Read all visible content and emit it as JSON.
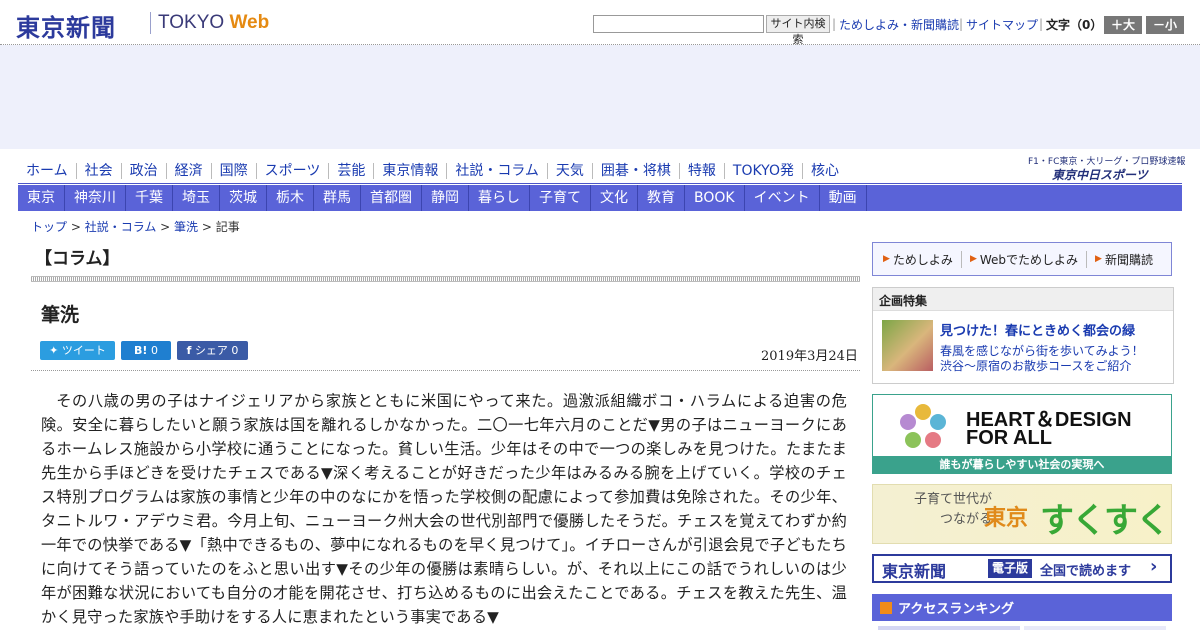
{
  "header": {
    "logo_jp": "東京新聞",
    "logo_en_tokyo": "TOKYO",
    "logo_en_web": "Web",
    "search_button": "サイト内検索",
    "links": [
      "ためしよみ・新聞購読",
      "サイトマップ"
    ],
    "moji_label": "文字（0）",
    "moji_plus": "＋大",
    "moji_minus": "－小"
  },
  "nav_main": [
    "ホーム",
    "社会",
    "政治",
    "経済",
    "国際",
    "スポーツ",
    "芸能",
    "東京情報",
    "社説・コラム",
    "天気",
    "囲碁・将棋",
    "特報",
    "TOKYO発",
    "核心"
  ],
  "chunichi": {
    "top_line": "F1・FC東京・大リーグ・プロ野球速報",
    "logo": "東京中日スポーツ"
  },
  "nav_region": [
    "東京",
    "神奈川",
    "千葉",
    "埼玉",
    "茨城",
    "栃木",
    "群馬",
    "首都圏",
    "静岡",
    "暮らし",
    "子育て",
    "文化",
    "教育",
    "BOOK",
    "イベント",
    "動画"
  ],
  "breadcrumb": {
    "items": [
      "トップ",
      "社説・コラム",
      "筆洗"
    ],
    "sep": " > ",
    "current": "記事"
  },
  "article": {
    "section": "【コラム】",
    "title": "筆洗",
    "tweet": "ツイート",
    "hatena_mark": "B!",
    "hatena_count": "0",
    "share_label": "シェア",
    "share_count": "0",
    "date": "2019年3月24日",
    "body": "その八歳の男の子はナイジェリアから家族とともに米国にやって来た。過激派組織ボコ・ハラムによる迫害の危険。安全に暮らしたいと願う家族は国を離れるしかなかった。二〇一七年六月のことだ▼男の子はニューヨークにあるホームレス施設から小学校に通うことになった。貧しい生活。少年はその中で一つの楽しみを見つけた。たまたま先生から手ほどきを受けたチェスである▼深く考えることが好きだった少年はみるみる腕を上げていく。学校のチェス特別プログラムは家族の事情と少年の中のなにかを悟った学校側の配慮によって参加費は免除された。その少年、タニトルワ・アデウミ君。今月上旬、ニューヨーク州大会の世代別部門で優勝したそうだ。チェスを覚えてわずか約一年での快挙である▼「熱中できるもの、夢中になれるものを早く見つけて」。イチローさんが引退会見で子どもたちに向けてそう語っていたのをふと思い出す▼その少年の優勝は素晴らしい。が、それ以上にこの話でうれしいのは少年が困難な状況においても自分の才能を開花させ、打ち込めるものに出会えたことである。チェスを教えた先生、温かく見守った家族や手助けをする人に恵まれたという事実である▼"
  },
  "sidebar": {
    "subscribe": [
      "ためしよみ",
      "Webでためしよみ",
      "新聞購読"
    ],
    "kikaku_head": "企画特集",
    "kikaku_title": "見つけた！春にときめく都会の緑",
    "kikaku_desc1": "春風を感じながら街を歩いてみよう！",
    "kikaku_desc2": "渋谷～原宿のお散歩コースをご紹介",
    "hd_line1": "HEART＆DESIGN",
    "hd_line2": "FOR ALL",
    "hd_bar": "誰もが暮らしやすい社会の実現へ",
    "suku_left1": "子育て世代が",
    "suku_left2": "つながる",
    "suku_tokyo": "東京",
    "suku_main": "すくすく",
    "denshi_logo": "東京新聞",
    "denshi_tag": "電子版",
    "denshi_text": "全国で読めます",
    "ranking": "アクセスランキング"
  },
  "colors": {
    "brand_blue": "#2c3a9c",
    "nav_blue": "#5a63d8",
    "link": "#1a3bb0",
    "tweet": "#2b9de0",
    "accent_orange": "#e58a12",
    "hd_green": "#3aa28c"
  }
}
